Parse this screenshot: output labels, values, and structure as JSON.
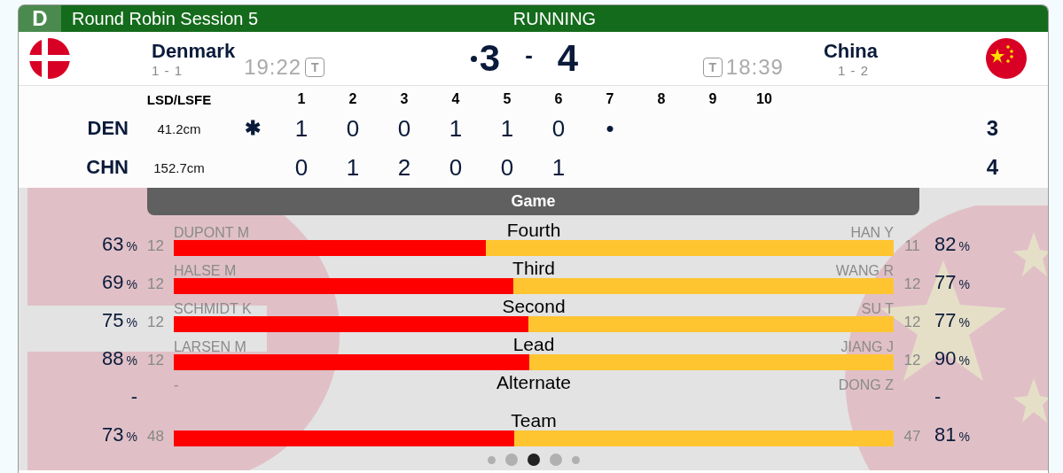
{
  "header": {
    "badge": "D",
    "title": "Round Robin Session 5",
    "status": "RUNNING"
  },
  "teams": [
    {
      "name": "Denmark",
      "record": "1 - 1",
      "time": "19:22",
      "timeout": "T",
      "score": "3",
      "hammer": true,
      "kind": "cross"
    },
    {
      "name": "China",
      "record": "1 - 2",
      "time": "18:39",
      "timeout": "T",
      "score": "4",
      "hammer": false,
      "kind": "stars"
    }
  ],
  "score_separator": "-",
  "linescore": {
    "lsd_heading": "LSD/LSFE",
    "ends": [
      "1",
      "2",
      "3",
      "4",
      "5",
      "6",
      "7",
      "8",
      "9",
      "10"
    ],
    "rows": [
      {
        "team": "DEN",
        "lsd": "41.2cm",
        "marker": "✱",
        "ends": [
          "1",
          "0",
          "0",
          "1",
          "1",
          "0",
          "•"
        ],
        "total": "3"
      },
      {
        "team": "CHN",
        "lsd": "152.7cm",
        "ends": [
          "0",
          "1",
          "2",
          "0",
          "0",
          "1"
        ],
        "total": "4"
      }
    ]
  },
  "section": "Game",
  "positions": [
    {
      "position": "Fourth",
      "left": {
        "pct": "63",
        "unit": "%",
        "count": "12",
        "name": "DUPONT M"
      },
      "right": {
        "pct": "82",
        "unit": "%",
        "count": "11",
        "name": "HAN Y"
      },
      "level": 0.433
    },
    {
      "position": "Third",
      "left": {
        "pct": "69",
        "unit": "%",
        "count": "12",
        "name": "HALSE M"
      },
      "right": {
        "pct": "77",
        "unit": "%",
        "count": "12",
        "name": "WANG R"
      },
      "level": 0.472
    },
    {
      "position": "Second",
      "left": {
        "pct": "75",
        "unit": "%",
        "count": "12",
        "name": "SCHMIDT K"
      },
      "right": {
        "pct": "77",
        "unit": "%",
        "count": "12",
        "name": "SU T"
      },
      "level": 0.493
    },
    {
      "position": "Lead",
      "left": {
        "pct": "88",
        "unit": "%",
        "count": "12",
        "name": "LARSEN M"
      },
      "right": {
        "pct": "90",
        "unit": "%",
        "count": "12",
        "name": "JIANG J"
      },
      "level": 0.494
    },
    {
      "position": "Alternate",
      "left": {
        "pct": "-",
        "name": "-"
      },
      "right": {
        "pct": "-",
        "name": "DONG Z"
      }
    },
    {
      "position": "Team",
      "left": {
        "pct": "73",
        "unit": "%",
        "count": "48"
      },
      "right": {
        "pct": "81",
        "unit": "%",
        "count": "47"
      },
      "level": 0.473
    }
  ],
  "pager": [
    {
      "selected": false
    },
    {
      "selected": false
    },
    {
      "selected": true
    },
    {
      "selected": false
    },
    {
      "selected": false
    }
  ]
}
